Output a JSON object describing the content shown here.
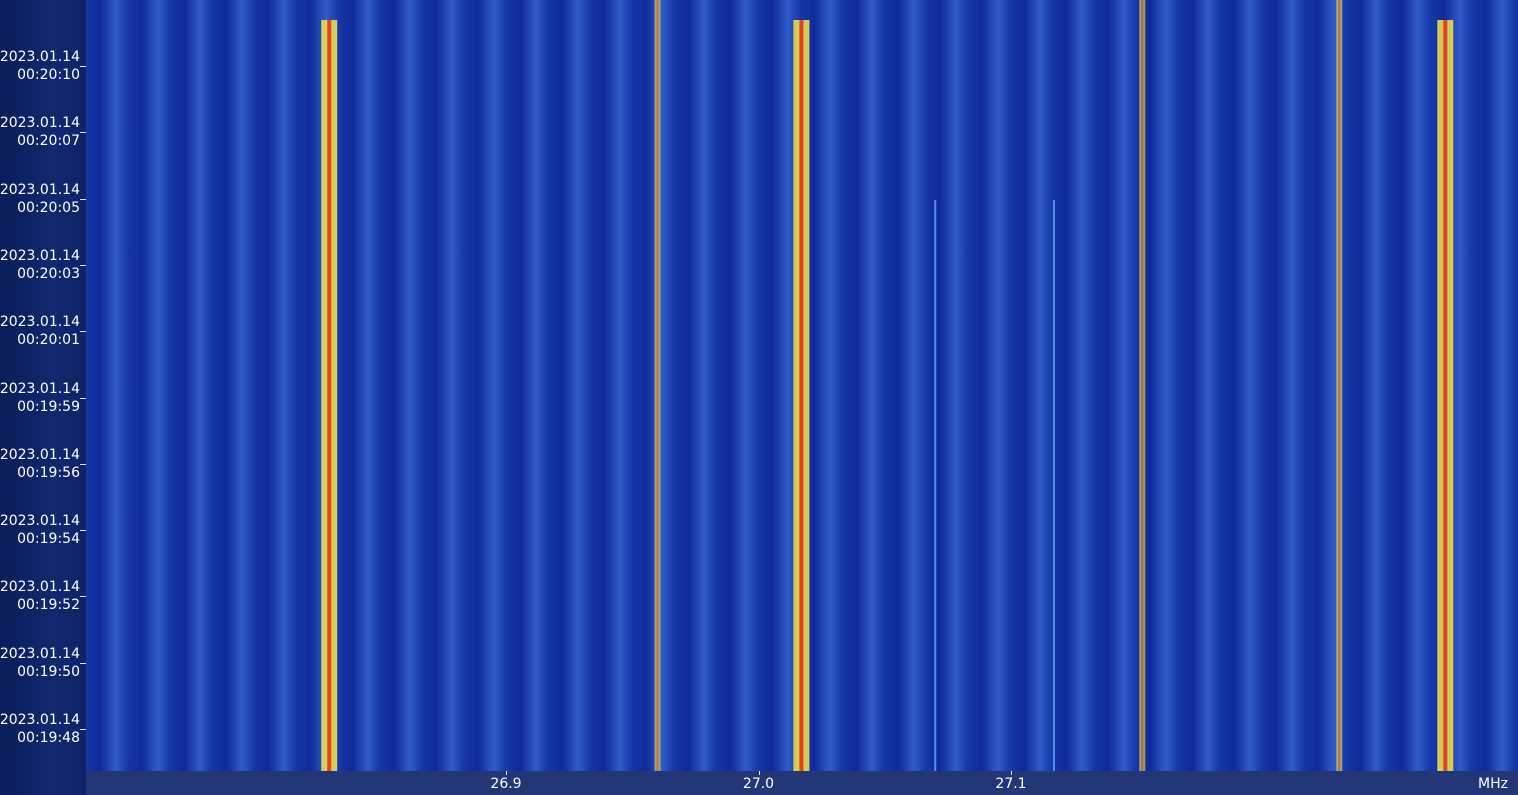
{
  "time_axis": {
    "labels": [
      {
        "date": "2023.01.14",
        "time": "00:20:10"
      },
      {
        "date": "2023.01.14",
        "time": "00:20:07"
      },
      {
        "date": "2023.01.14",
        "time": "00:20:05"
      },
      {
        "date": "2023.01.14",
        "time": "00:20:03"
      },
      {
        "date": "2023.01.14",
        "time": "00:20:01"
      },
      {
        "date": "2023.01.14",
        "time": "00:19:59"
      },
      {
        "date": "2023.01.14",
        "time": "00:19:56"
      },
      {
        "date": "2023.01.14",
        "time": "00:19:54"
      },
      {
        "date": "2023.01.14",
        "time": "00:19:52"
      },
      {
        "date": "2023.01.14",
        "time": "00:19:50"
      },
      {
        "date": "2023.01.14",
        "time": "00:19:48"
      }
    ]
  },
  "freq_axis": {
    "ticks": [
      {
        "value_mhz": 26.9,
        "label": "26.9"
      },
      {
        "value_mhz": 27.0,
        "label": "27.0"
      },
      {
        "value_mhz": 27.1,
        "label": "27.1"
      }
    ],
    "unit": "MHz"
  },
  "colors": {
    "background": "#1638a8",
    "signal_weak": "#5c9cf0",
    "signal_mid": "#f2e84a",
    "signal_strong": "#e8321e"
  },
  "signals": [
    {
      "freq_mhz": 26.83,
      "strength": "strong"
    },
    {
      "freq_mhz": 26.96,
      "strength": "mid"
    },
    {
      "freq_mhz": 27.017,
      "strength": "strong"
    },
    {
      "freq_mhz": 27.07,
      "strength": "weak"
    },
    {
      "freq_mhz": 27.117,
      "strength": "weak"
    },
    {
      "freq_mhz": 27.152,
      "strength": "mid"
    },
    {
      "freq_mhz": 27.23,
      "strength": "mid"
    },
    {
      "freq_mhz": 27.272,
      "strength": "strong"
    }
  ]
}
